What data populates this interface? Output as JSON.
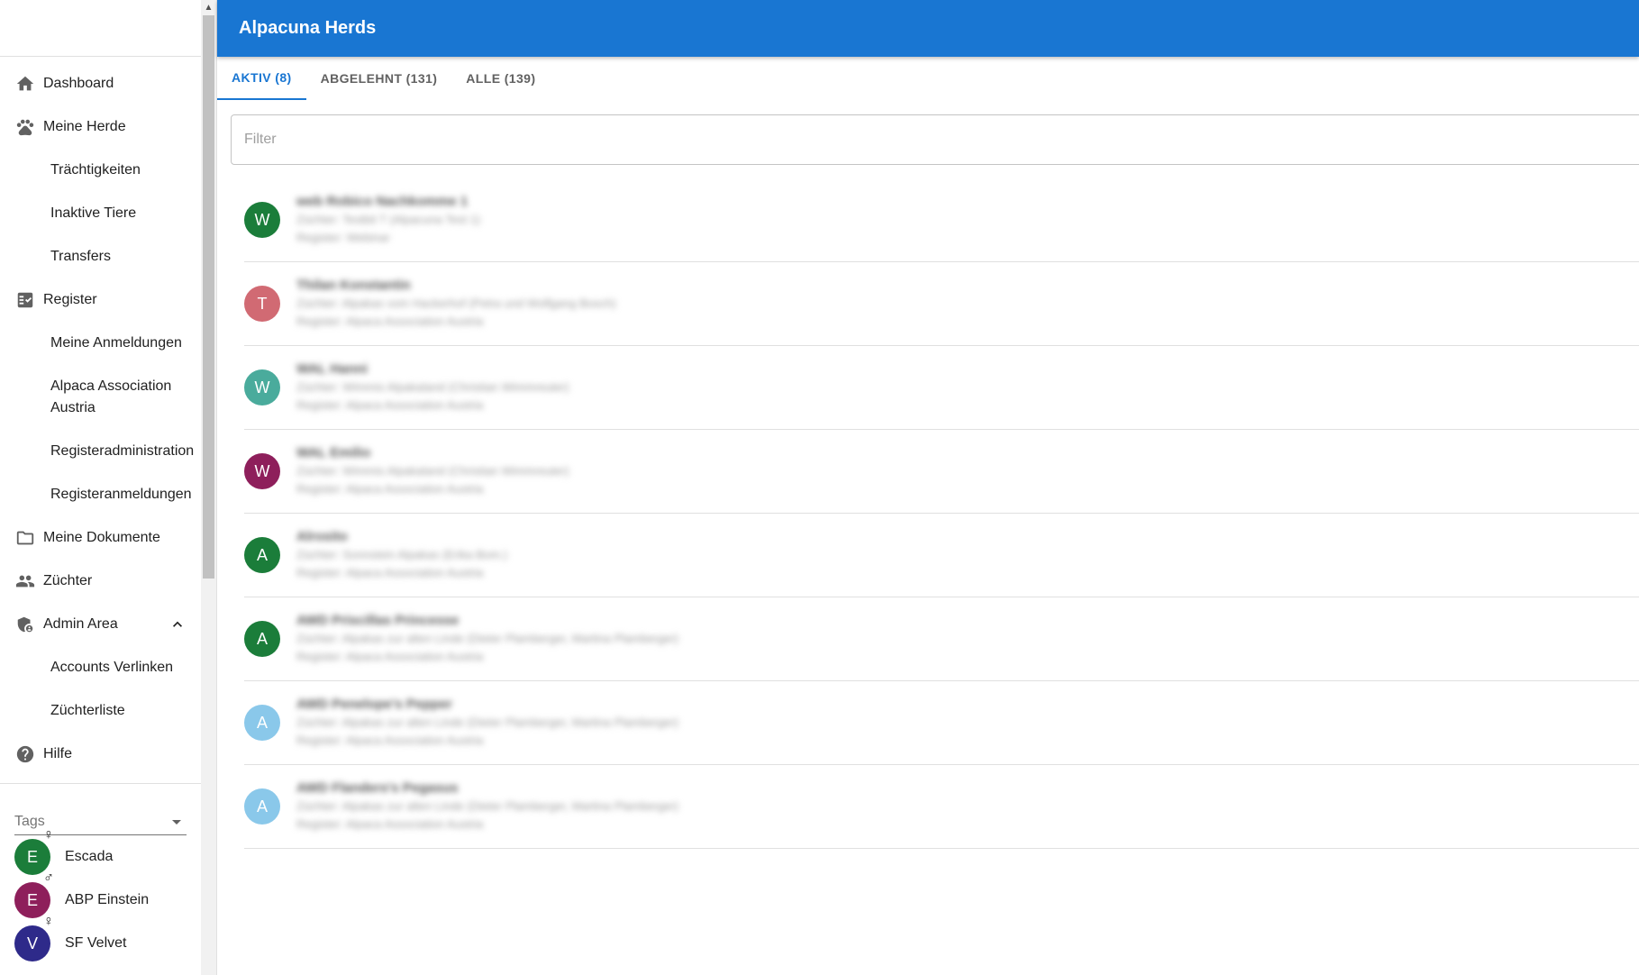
{
  "sidebar": {
    "items": [
      {
        "label": "Dashboard",
        "icon": "home-icon"
      },
      {
        "label": "Meine Herde",
        "icon": "paw-icon"
      },
      {
        "label": "Trächtigkeiten"
      },
      {
        "label": "Inaktive Tiere"
      },
      {
        "label": "Transfers"
      },
      {
        "label": "Register",
        "icon": "checklist-icon"
      },
      {
        "label": "Meine Anmeldungen"
      },
      {
        "label": "Alpaca Association Austria"
      },
      {
        "label": "Registeradministration"
      },
      {
        "label": "Registeranmeldungen"
      },
      {
        "label": "Meine Dokumente",
        "icon": "folder-icon"
      },
      {
        "label": "Züchter",
        "icon": "people-icon"
      },
      {
        "label": "Admin Area",
        "icon": "admin-shield-icon"
      },
      {
        "label": "Accounts Verlinken"
      },
      {
        "label": "Züchterliste"
      },
      {
        "label": "Hilfe",
        "icon": "help-icon"
      }
    ],
    "tags_label": "Tags",
    "tags": [
      {
        "initial": "E",
        "name": "Escada",
        "gender": "♀",
        "color": "#1b7d3a"
      },
      {
        "initial": "E",
        "name": "ABP Einstein",
        "gender": "♂",
        "color": "#8e1f5b"
      },
      {
        "initial": "V",
        "name": "SF Velvet",
        "gender": "♀",
        "color": "#2e2a8a"
      }
    ]
  },
  "header": {
    "title": "Alpacuna Herds"
  },
  "tabs": [
    {
      "label": "AKTIV (8)"
    },
    {
      "label": "ABGELEHNT (131)"
    },
    {
      "label": "ALLE (139)"
    }
  ],
  "filter": {
    "placeholder": "Filter",
    "value": ""
  },
  "animals": [
    {
      "initial": "W",
      "color": "#1b7d3a",
      "name": "web Robico Nachkomme 1",
      "breeder": "Züchter: Testbit T (Alpacuna Test 1)",
      "register": "Register: Webinar"
    },
    {
      "initial": "T",
      "color": "#d16a73",
      "name": "Thilan Konstantin",
      "breeder": "Züchter: Alpakas vom Hackerhof (Petra und Wolfgang Bosch)",
      "register": "Register: Alpaca Association Austria"
    },
    {
      "initial": "W",
      "color": "#4aab9c",
      "name": "WAL Hanni",
      "breeder": "Züchter: Wimmis Alpakaland (Christian Wimmreuter)",
      "register": "Register: Alpaca Association Austria"
    },
    {
      "initial": "W",
      "color": "#8e1f5b",
      "name": "WAL Emilio",
      "breeder": "Züchter: Wimmis Alpakaland (Christian Wimmreuter)",
      "register": "Register: Alpaca Association Austria"
    },
    {
      "initial": "A",
      "color": "#1b7d3a",
      "name": "Alrosito",
      "breeder": "Züchter: Sonnstein Alpakas (Erika Bom.)",
      "register": "Register: Alpaca Association Austria"
    },
    {
      "initial": "A",
      "color": "#1b7d3a",
      "name": "AWD Priscillas Princesse",
      "breeder": "Züchter: Alpakas zur alten Linde (Dieter Plamberger, Martina Plamberger)",
      "register": "Register: Alpaca Association Austria"
    },
    {
      "initial": "A",
      "color": "#8ac8ea",
      "name": "AWD Penelope's Pepper",
      "breeder": "Züchter: Alpakas zur alten Linde (Dieter Plamberger, Martina Plamberger)",
      "register": "Register: Alpaca Association Austria"
    },
    {
      "initial": "A",
      "color": "#8ac8ea",
      "name": "AWD Flanders's Pegasus",
      "breeder": "Züchter: Alpakas zur alten Linde (Dieter Plamberger, Martina Plamberger)",
      "register": "Register: Alpaca Association Austria"
    }
  ]
}
